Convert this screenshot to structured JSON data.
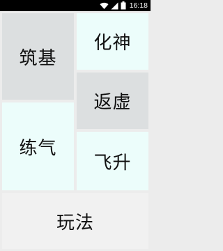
{
  "status_bar": {
    "time": "16:18",
    "icons": [
      "wifi-icon",
      "signal-icon",
      "battery-icon"
    ]
  },
  "tiles": {
    "zhuji": "筑基",
    "huashen": "化神",
    "fanxu": "返虚",
    "lianqi": "练气",
    "feisheng": "飞升",
    "wanfa": "玩法"
  },
  "colors": {
    "gray_tile": "#dcdfe0",
    "cyan_tile": "#ecfdfb",
    "bottom_tile": "#f1f1f1",
    "background": "#ececec",
    "status_bar": "#000000"
  }
}
